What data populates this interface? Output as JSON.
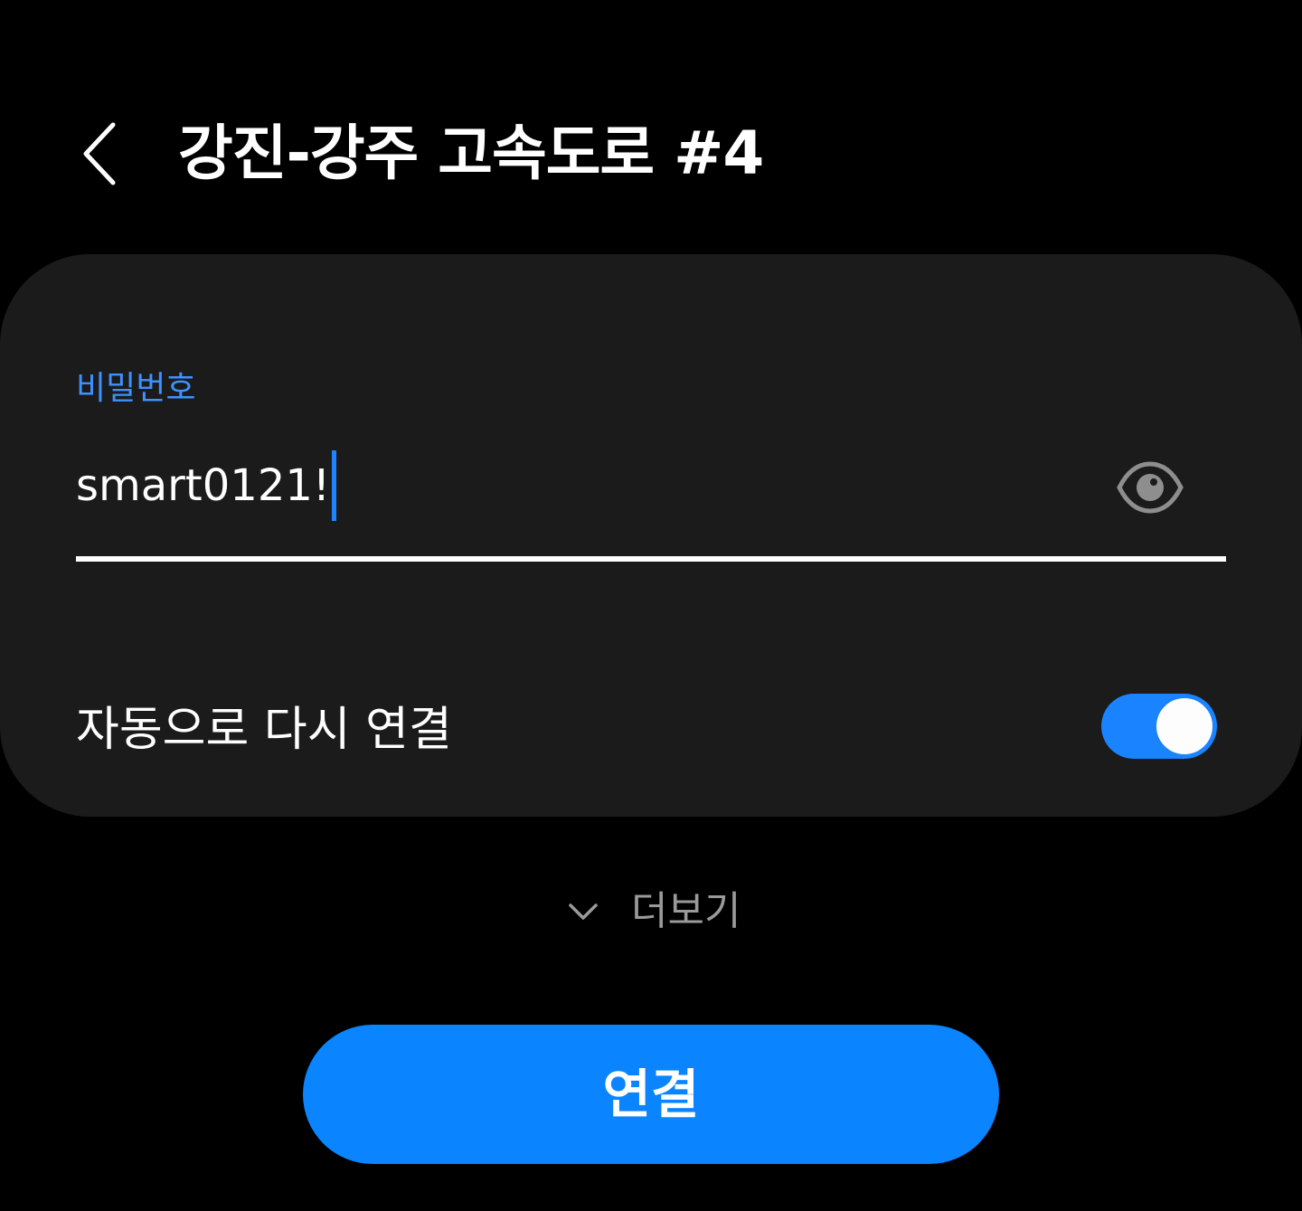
{
  "header": {
    "back_icon": "chevron-left-icon",
    "title": "강진-강주 고속도로 #4"
  },
  "password": {
    "label": "비밀번호",
    "value": "smart0121!",
    "visibility_icon": "eye-icon",
    "label_color": "#3e91ff",
    "caret_color": "#1f84ff"
  },
  "auto_reconnect": {
    "label": "자동으로 다시 연결",
    "enabled": true,
    "toggle_color": "#1a83ff"
  },
  "more": {
    "icon": "chevron-down-icon",
    "label": "더보기"
  },
  "connect": {
    "label": "연결",
    "color": "#0a84ff"
  }
}
